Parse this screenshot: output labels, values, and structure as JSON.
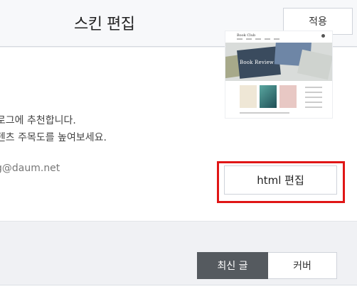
{
  "header": {
    "title": "스킨 편집",
    "apply_label": "적용"
  },
  "info": {
    "description_line_1": "블로그에 추천합니다.",
    "description_line_2": "콘텐츠 주목도를 높여보세요.",
    "email": "g@daum.net"
  },
  "thumbnail": {
    "logo_text": "Book Club",
    "hero_title": "Book Review"
  },
  "edit": {
    "html_edit_label": "html 편집"
  },
  "tabs": [
    {
      "label": "최신 글",
      "active": true
    },
    {
      "label": "커버",
      "active": false
    }
  ],
  "colors": {
    "highlight": "#e01616",
    "active_tab": "#555a5f"
  }
}
